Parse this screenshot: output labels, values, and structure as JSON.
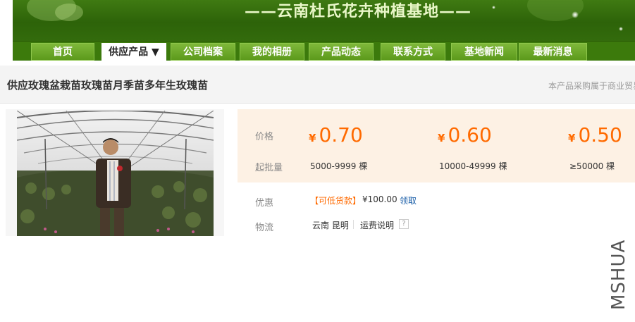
{
  "header": {
    "site_title": "——云南杜氏花卉种植基地——"
  },
  "nav": {
    "items": [
      {
        "label": "首页"
      },
      {
        "label": "供应产品 ▼"
      },
      {
        "label": "公司档案"
      },
      {
        "label": "我的相册"
      },
      {
        "label": "产品动态"
      },
      {
        "label": "联系方式"
      },
      {
        "label": "基地新闻"
      },
      {
        "label": "最新消息"
      }
    ]
  },
  "product": {
    "title": "供应玫瑰盆栽苗玫瑰苗月季苗多年生玫瑰苗",
    "business_note": "本产品采购属于商业贸易"
  },
  "pricing": {
    "price_label": "价格",
    "moq_label": "起批量",
    "currency_symbol": "¥",
    "tiers": [
      {
        "price": "0.70",
        "quantity": "5000-9999 棵"
      },
      {
        "price": "0.60",
        "quantity": "10000-49999 棵"
      },
      {
        "price": "0.50",
        "quantity": "≥50000 棵"
      }
    ]
  },
  "promotion": {
    "label": "优惠",
    "tag": "【可低货款】",
    "amount": "¥100.00",
    "claim_link": "领取"
  },
  "logistics": {
    "label": "物流",
    "location": "云南 昆明",
    "shipping_link": "运费说明",
    "help_glyph": "?"
  },
  "watermark": {
    "text": "MSHUA"
  },
  "colors": {
    "brand_green": "#3c7a0c",
    "price_orange": "#ff6a00",
    "price_panel_bg": "#fdf1e4",
    "link_blue": "#1a5ea8"
  }
}
